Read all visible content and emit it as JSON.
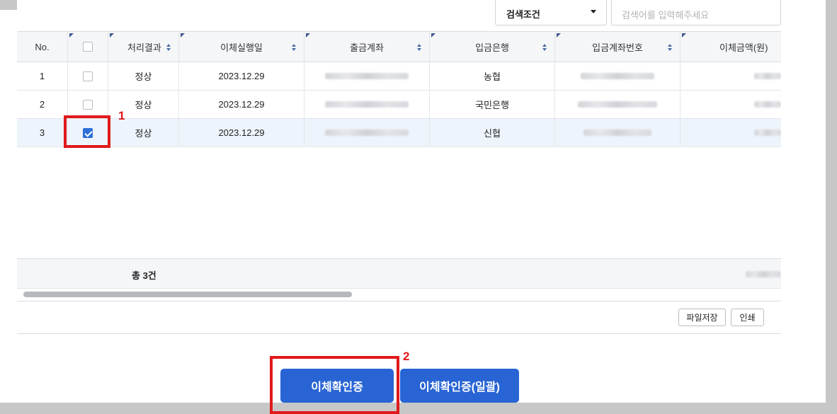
{
  "search": {
    "condition_label": "검색조건",
    "placeholder": "검색어를 입력해주세요"
  },
  "table": {
    "headers": [
      "No.",
      "",
      "처리결과",
      "이체실행일",
      "출금계좌",
      "입금은행",
      "입금계좌번호",
      "이체금액(원)"
    ],
    "rows": [
      {
        "no": "1",
        "checked": false,
        "result": "정상",
        "date": "2023.12.29",
        "bank": "농협"
      },
      {
        "no": "2",
        "checked": false,
        "result": "정상",
        "date": "2023.12.29",
        "bank": "국민은행"
      },
      {
        "no": "3",
        "checked": true,
        "result": "정상",
        "date": "2023.12.29",
        "bank": "신협"
      }
    ],
    "total_label": "총 3건"
  },
  "toolbar": {
    "save_label": "파일저장",
    "print_label": "인쇄"
  },
  "actions": {
    "confirm_label": "이체확인증",
    "confirm_all_label": "이체확인증(일괄)"
  },
  "annotations": {
    "marker1": "1",
    "marker2": "2"
  },
  "colors": {
    "primary_button": "#2864d4",
    "annotation": "#e0191b",
    "selected_row": "#eef4fc",
    "checkbox_checked": "#2e6fd8"
  }
}
